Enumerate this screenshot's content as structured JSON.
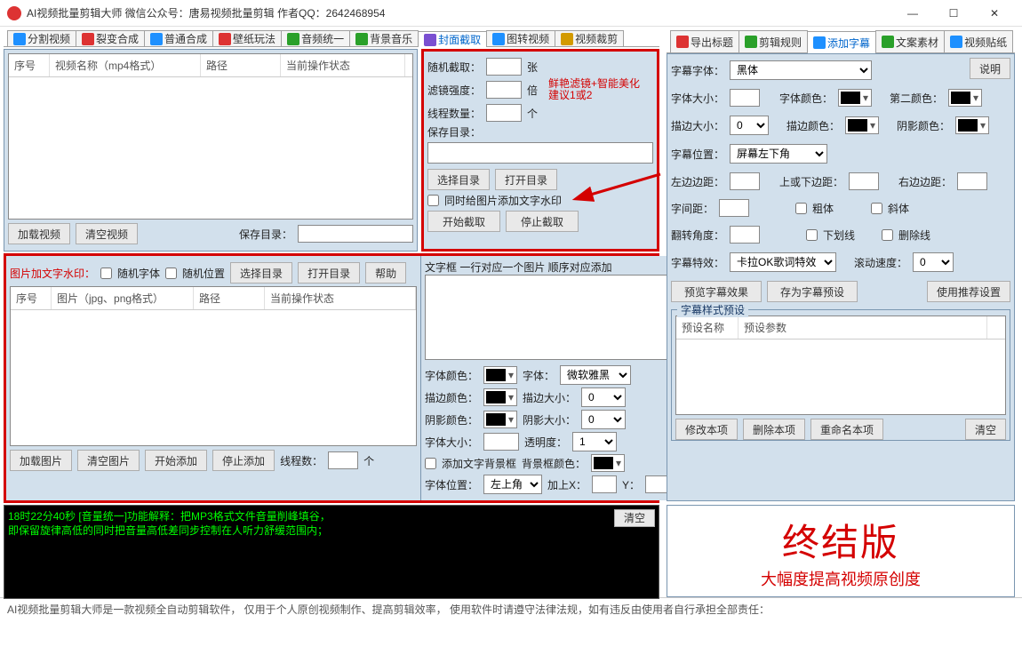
{
  "window": {
    "title": "AI视频批量剪辑大师   微信公众号：唐易视频批量剪辑    作者QQ：2642468954"
  },
  "tabsLeft": [
    {
      "label": "分割视频",
      "icon": "#1e90ff"
    },
    {
      "label": "裂变合成",
      "icon": "#d33"
    },
    {
      "label": "普通合成",
      "icon": "#1e90ff"
    },
    {
      "label": "壁纸玩法",
      "icon": "#d33"
    },
    {
      "label": "音频统一",
      "icon": "#2aa02a"
    },
    {
      "label": "背景音乐",
      "icon": "#2aa02a"
    },
    {
      "label": "封面截取",
      "icon": "#7a4fd1",
      "active": true
    },
    {
      "label": "图转视频",
      "icon": "#1e90ff"
    },
    {
      "label": "视频裁剪",
      "icon": "#d39a00"
    }
  ],
  "tabsRight": [
    {
      "label": "导出标题",
      "icon": "#d33"
    },
    {
      "label": "剪辑规则",
      "icon": "#2aa02a"
    },
    {
      "label": "添加字幕",
      "icon": "#1e90ff",
      "active": true
    },
    {
      "label": "文案素材",
      "icon": "#2aa02a"
    },
    {
      "label": "视频贴纸",
      "icon": "#1e90ff"
    }
  ],
  "videoGrid": {
    "cols": [
      "序号",
      "视频名称（mp4格式）",
      "路径",
      "当前操作状态"
    ]
  },
  "videoBtns": {
    "load": "加载视频",
    "clear": "清空视频",
    "saveDirLabel": "保存目录：",
    "saveDir": ""
  },
  "cover": {
    "randLabel": "随机截取：",
    "randUnit": "张",
    "filterLabel": "滤镜强度：",
    "filterUnit": "倍",
    "filterHint": "鲜艳滤镜+智能美化 建议1或2",
    "threadLabel": "线程数量：",
    "threadUnit": "个",
    "saveLabel": "保存目录：",
    "chooseDir": "选择目录",
    "openDir": "打开目录",
    "chkWatermark": "同时给图片添加文字水印",
    "start": "开始截取",
    "stop": "停止截取"
  },
  "picPanel": {
    "title": "图片加文字水印：",
    "chkRandFont": "随机字体",
    "chkRandPos": "随机位置",
    "chooseDir": "选择目录",
    "openDir": "打开目录",
    "help": "帮助",
    "cols": [
      "序号",
      "图片（jpg、png格式）",
      "路径",
      "当前操作状态"
    ],
    "load": "加载图片",
    "clear": "清空图片",
    "startAdd": "开始添加",
    "stopAdd": "停止添加",
    "threadLabel": "线程数：",
    "threadUnit": "个"
  },
  "txtPanel": {
    "hint": "文字框 一行对应一个图片 顺序对应添加",
    "fontColor": "字体颜色：",
    "fontLabel": "字体：",
    "fontVal": "微软雅黑",
    "strokeColor": "描边颜色：",
    "strokeSize": "描边大小：",
    "strokeVal": "0",
    "shadowColor": "阴影颜色：",
    "shadowSize": "阴影大小：",
    "shadowVal": "0",
    "fontSize": "字体大小：",
    "opacity": "透明度：",
    "opacityVal": "1",
    "addBg": "添加文字背景框",
    "bgColor": "背景框颜色：",
    "pos": "字体位置：",
    "posVal": "左上角",
    "addX": "加上X：",
    "y": "Y："
  },
  "log": {
    "line1": "18时22分40秒 [音量统一]功能解释：把MP3格式文件音量削峰填谷，",
    "line2": "    即保留旋律高低的同时把音量高低差同步控制在人听力舒缓范围内；",
    "clear": "清空"
  },
  "sub": {
    "explain": "说明",
    "fontFamLabel": "字幕字体：",
    "fontFamVal": "黑体",
    "fontSize": "字体大小：",
    "fontColor": "字体颜色：",
    "secondColor": "第二颜色：",
    "strokeSize": "描边大小：",
    "strokeVal": "0",
    "strokeColor": "描边颜色：",
    "shadowColor": "阴影颜色：",
    "pos": "字幕位置：",
    "posVal": "屏幕左下角",
    "leftDist": "左边边距：",
    "topBotDist": "上或下边距：",
    "rightDist": "右边边距：",
    "spacing": "字间距：",
    "bold": "粗体",
    "italic": "斜体",
    "rotate": "翻转角度：",
    "underline": "下划线",
    "strike": "删除线",
    "effect": "字幕特效：",
    "effectVal": "卡拉OK歌词特效",
    "scroll": "滚动速度：",
    "scrollVal": "0",
    "preview": "预览字幕效果",
    "savePreset": "存为字幕预设",
    "useRec": "使用推荐设置",
    "presetTitle": "字幕样式预设",
    "presetCols": [
      "预设名称",
      "预设参数"
    ],
    "modifyItem": "修改本项",
    "delItem": "删除本项",
    "renameItem": "重命名本项",
    "clear": "清空"
  },
  "brand": {
    "big": "终结版",
    "sub": "大幅度提高视频原创度"
  },
  "footer": "AI视频批量剪辑大师是一款视频全自动剪辑软件，  仅用于个人原创视频制作、提高剪辑效率，  使用软件时请遵守法律法规，如有违反由使用者自行承担全部责任："
}
